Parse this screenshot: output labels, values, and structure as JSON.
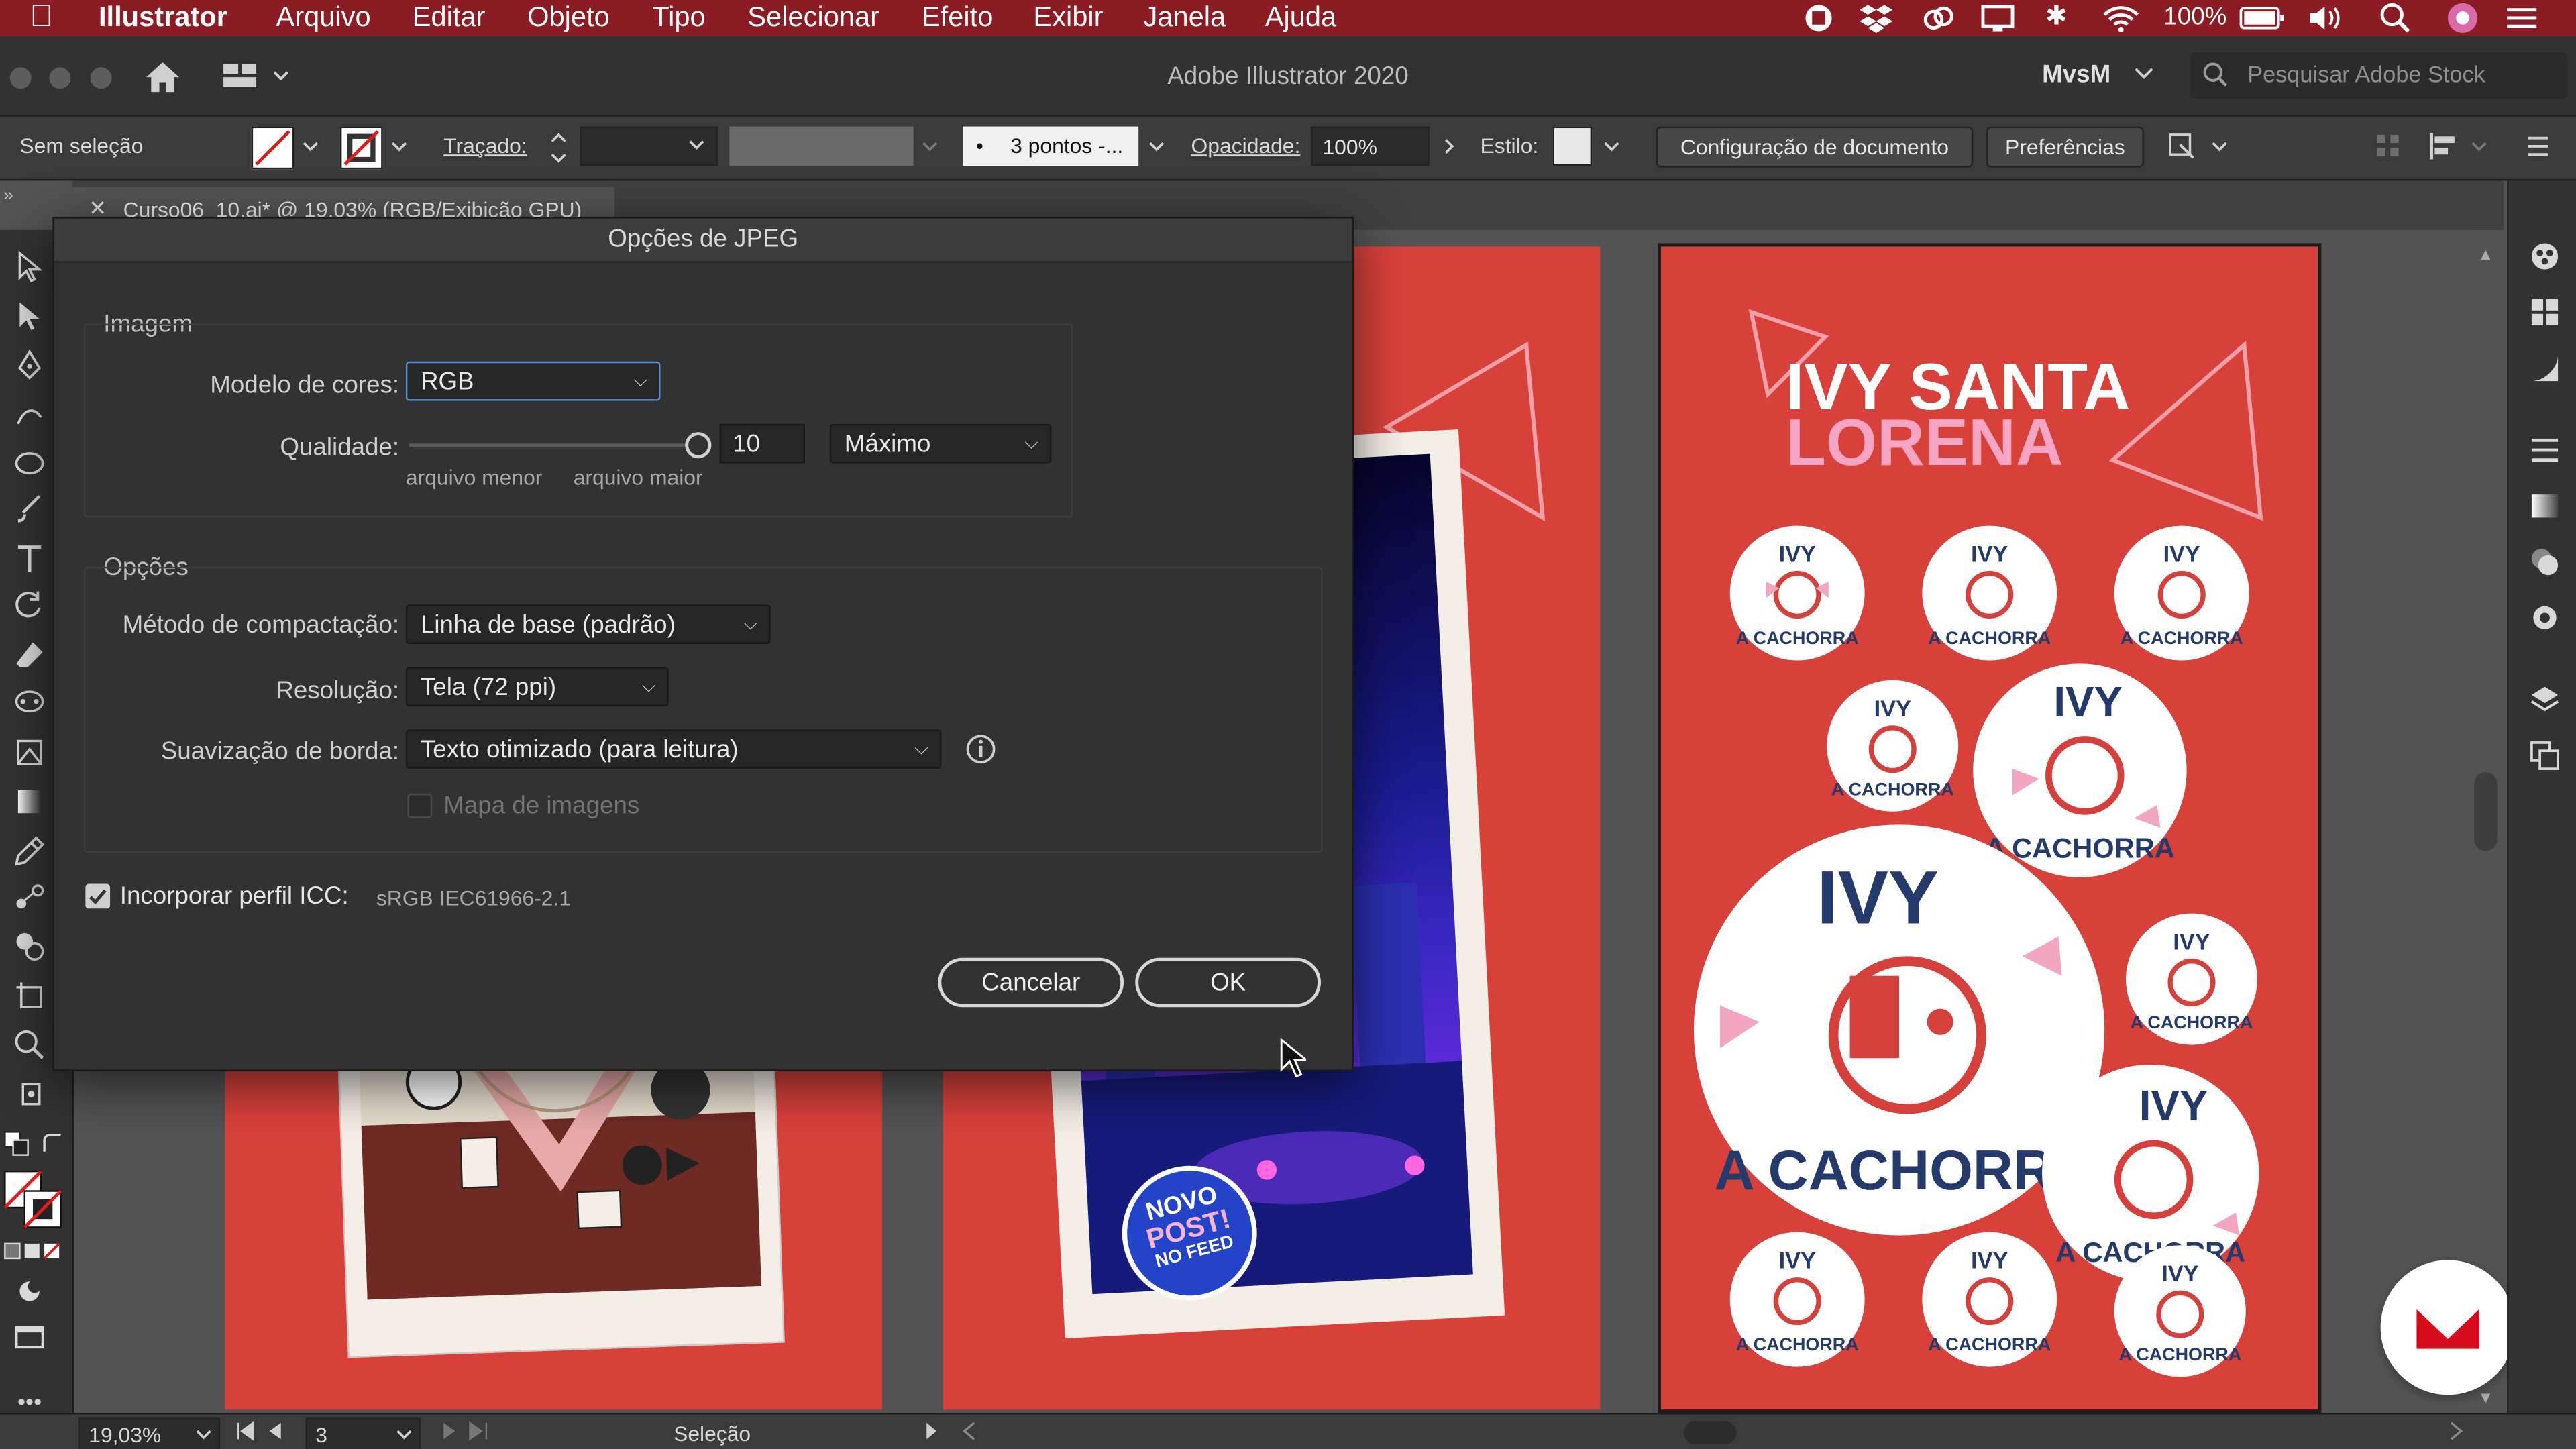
{
  "menubar": {
    "apple_glyph": "",
    "app_name": "Illustrator",
    "items": [
      "Arquivo",
      "Editar",
      "Objeto",
      "Tipo",
      "Selecionar",
      "Efeito",
      "Exibir",
      "Janela",
      "Ajuda"
    ],
    "battery": "100%"
  },
  "titlebar": {
    "title": "Adobe Illustrator 2020",
    "workspace": "MvsM",
    "search_placeholder": "Pesquisar Adobe Stock"
  },
  "controlbar": {
    "selection_label": "Sem seleção",
    "stroke_label": "Traçado:",
    "brush_value": "3 pontos -...",
    "opacity_label": "Opacidade:",
    "opacity_value": "100%",
    "style_label": "Estilo:",
    "doc_setup_button": "Configuração de documento",
    "prefs_button": "Preferências"
  },
  "tab": {
    "label": "Curso06_10.ai* @ 19,03% (RGB/Exibição GPU)"
  },
  "statusbar": {
    "zoom": "19,03%",
    "artboard": "3",
    "tool": "Seleção"
  },
  "dialog": {
    "title": "Opções de JPEG",
    "image_group": "Imagem",
    "color_model_label": "Modelo de cores:",
    "color_model_value": "RGB",
    "quality_label": "Qualidade:",
    "quality_value": "10",
    "quality_level": 1.0,
    "quality_preset": "Máximo",
    "smaller_file": "arquivo menor",
    "larger_file": "arquivo maior",
    "options_group": "Opções",
    "compression_label": "Método de compactação:",
    "compression_value": "Linha de base (padrão)",
    "resolution_label": "Resolução:",
    "resolution_value": "Tela (72 ppi)",
    "antialias_label": "Suavização de borda:",
    "antialias_value": "Texto otimizado (para leitura)",
    "imagemap_label": "Mapa de imagens",
    "imagemap_checked": false,
    "icc_label": "Incorporar perfil ICC:",
    "icc_value": "sRGB IEC61966-2.1",
    "icc_checked": true,
    "cancel_button": "Cancelar",
    "ok_button": "OK"
  },
  "artwork": {
    "title_line1": "IVY SANTA",
    "title_line2": "LORENA",
    "sticker_top": "IVY",
    "sticker_bottom": "A CACHORRA",
    "post_badge_1": "NOVO",
    "post_badge_2": "POST!",
    "post_badge_3": "NO FEED"
  },
  "colors": {
    "menubar": "#8c1c24",
    "artboard_red": "#d8413a",
    "sticker_navy": "#243a6b",
    "sticker_pink": "#f2a6bf",
    "brand_logo": "#d60b1b"
  }
}
